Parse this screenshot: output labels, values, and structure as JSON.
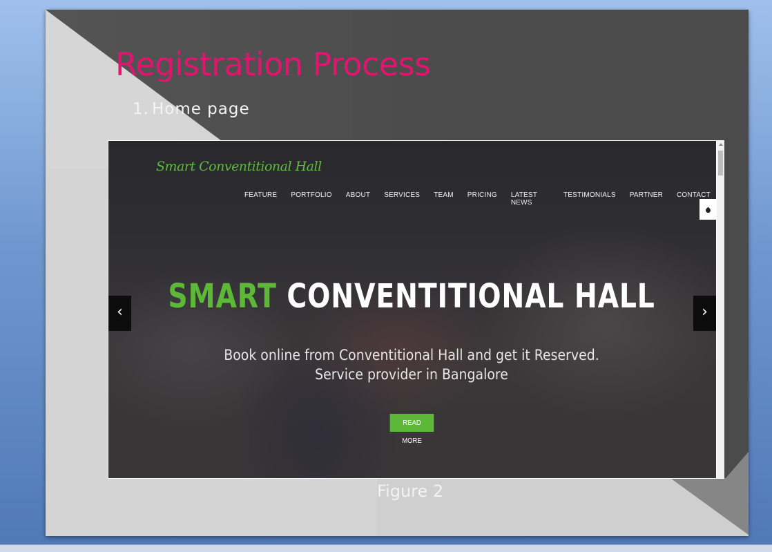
{
  "slide": {
    "title": "Registration Process",
    "bullet_number": "1.",
    "bullet_text": "Home page",
    "caption": "Figure 2"
  },
  "website": {
    "brand": "Smart Conventitional Hall",
    "nav": [
      "FEATURE",
      "PORTFOLIO",
      "ABOUT",
      "SERVICES",
      "TEAM",
      "PRICING",
      "LATEST NEWS",
      "TESTIMONIALS",
      "PARTNER",
      "CONTACT"
    ],
    "hero_title_accent": "SMART",
    "hero_title_rest": "CONVENTITIONAL HALL",
    "hero_line1": "Book online from Conventitional Hall and get it Reserved.",
    "hero_line2": "Service provider in Bangalore",
    "read_more": "READ MORE",
    "prev_arrow": "‹",
    "next_arrow": "›"
  },
  "colors": {
    "title_pink": "#e0166e",
    "brand_green": "#5cb836"
  }
}
